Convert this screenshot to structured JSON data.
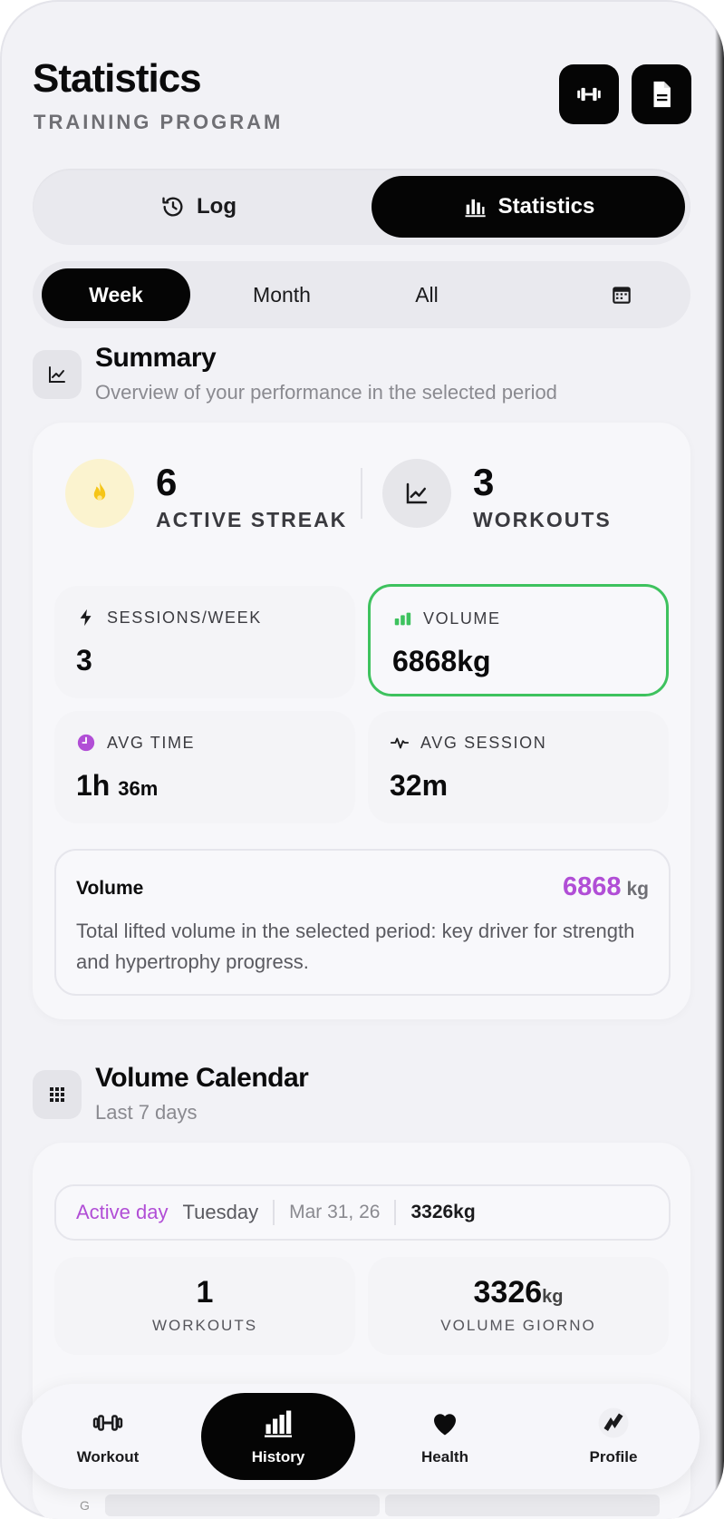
{
  "header": {
    "title": "Statistics",
    "subtitle": "TRAINING PROGRAM"
  },
  "view_toggle": {
    "log_label": "Log",
    "statistics_label": "Statistics",
    "selected": "Statistics"
  },
  "period_tabs": {
    "items": [
      "Week",
      "Month",
      "All"
    ],
    "selected": "Week"
  },
  "summary": {
    "title": "Summary",
    "subtitle": "Overview of your performance in the selected period",
    "streak": {
      "value": "6",
      "label": "ACTIVE STREAK"
    },
    "workouts": {
      "value": "3",
      "label": "WORKOUTS"
    },
    "tiles": {
      "sessions_week": {
        "label": "SESSIONS/WEEK",
        "value": "3"
      },
      "volume": {
        "label": "VOLUME",
        "value": "6868kg"
      },
      "avg_time": {
        "label": "AVG TIME",
        "value_main": "1h",
        "value_small": "36m"
      },
      "avg_session": {
        "label": "AVG SESSION",
        "value": "32m"
      }
    },
    "info": {
      "title": "Volume",
      "value": "6868",
      "unit": "kg",
      "text": "Total lifted volume in the selected period: key driver for strength and hypertrophy progress."
    }
  },
  "volume_calendar": {
    "title": "Volume Calendar",
    "subtitle": "Last 7 days",
    "active_row": {
      "active_label": "Active day",
      "day": "Tuesday",
      "date": "Mar 31, 26",
      "volume": "3326kg"
    },
    "workouts": {
      "value": "1",
      "label": "WORKOUTS"
    },
    "day_volume": {
      "value": "3326",
      "unit": "kg",
      "label": "VOLUME GIORNO"
    },
    "strip_label": "G"
  },
  "tabbar": {
    "workout": "Workout",
    "history": "History",
    "health": "Health",
    "profile": "Profile",
    "selected": "History"
  },
  "colors": {
    "accent_purple": "#b14ed6",
    "active_green": "#3ec25e",
    "dark": "#050505",
    "streak_yellow": "#f5c518"
  }
}
